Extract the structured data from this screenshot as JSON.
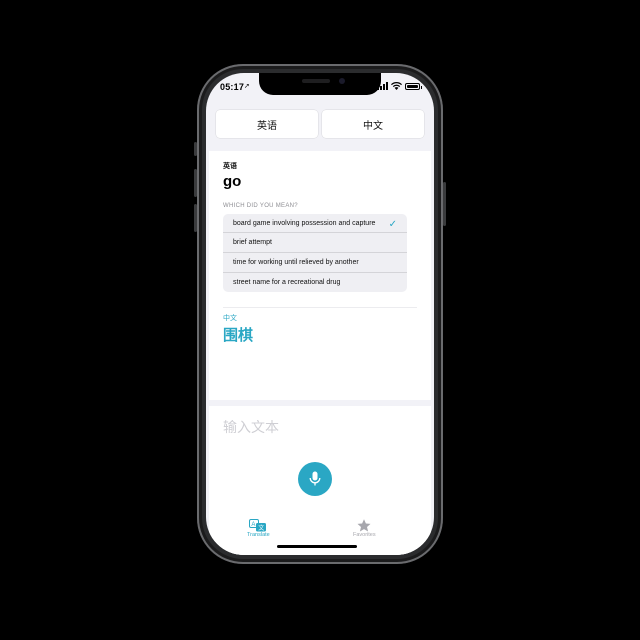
{
  "status_bar": {
    "time": "05:17",
    "location_arrow": "➚"
  },
  "language_bar": {
    "source_language": "英语",
    "target_language": "中文"
  },
  "result": {
    "source_label": "英语",
    "source_word": "go",
    "meaning_header": "WHICH DID YOU MEAN?",
    "options": [
      {
        "label": "board game involving possession and capture",
        "selected": true
      },
      {
        "label": "brief attempt",
        "selected": false
      },
      {
        "label": "time for working until relieved by another",
        "selected": false
      },
      {
        "label": "street name for a recreational drug",
        "selected": false
      }
    ],
    "check_mark": "✓",
    "target_label": "中文",
    "target_word": "围棋"
  },
  "input": {
    "placeholder": "输入文本"
  },
  "tabs": [
    {
      "label": "Translate",
      "icon": "translate-icon",
      "active": true
    },
    {
      "label": "Favorites",
      "icon": "star-icon",
      "active": false
    }
  ],
  "colors": {
    "accent": "#2aa7c4",
    "background": "#f2f2f7",
    "inactive": "#a7a7ad"
  }
}
